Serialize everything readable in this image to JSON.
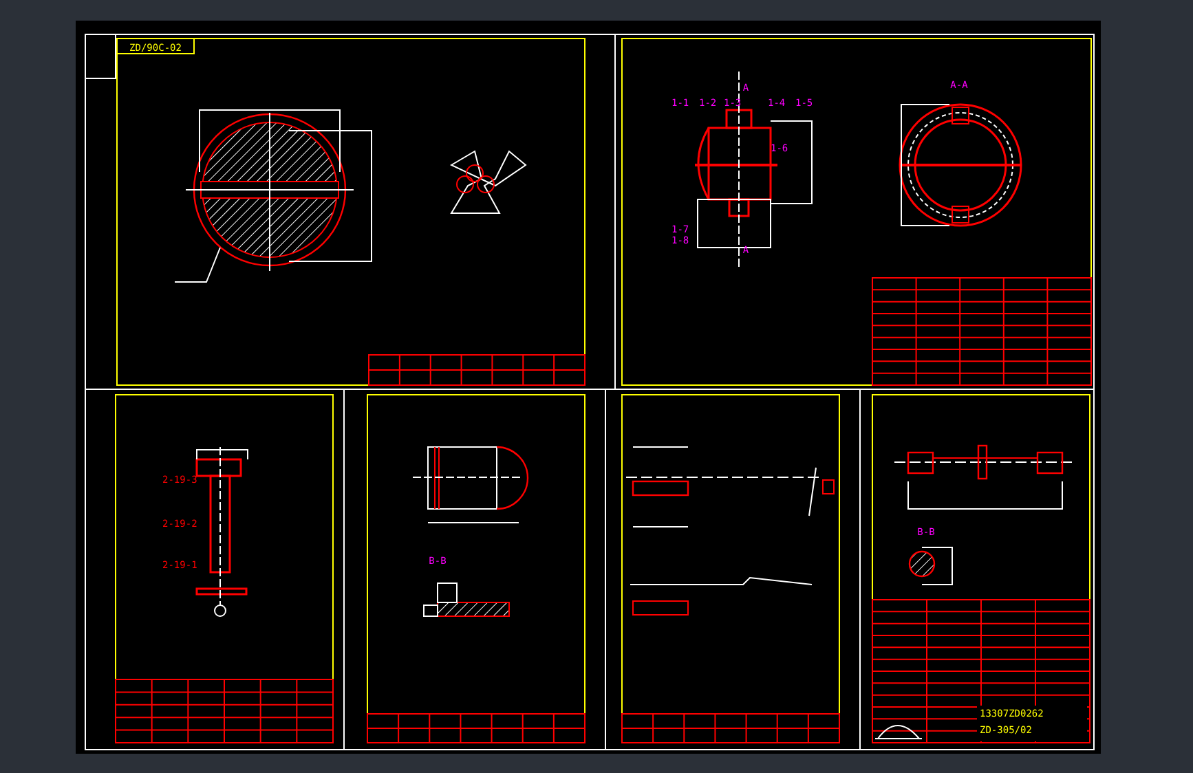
{
  "drawing_code": "ZD/90C-02",
  "vessel_labels": [
    "1-1",
    "1-2",
    "1-3",
    "1-4",
    "1-5",
    "1-6",
    "1-7",
    "1-8"
  ],
  "section_labels": [
    {
      "text": "A-A"
    },
    {
      "text": "A"
    },
    {
      "text": "A"
    },
    {
      "text": "B-B"
    },
    {
      "text": "B-B"
    }
  ],
  "part_labels": [
    "2-19-3",
    "2-19-2",
    "2-19-1"
  ],
  "title_block": {
    "number": "13307ZD0262",
    "code": "ZD-305/02"
  }
}
